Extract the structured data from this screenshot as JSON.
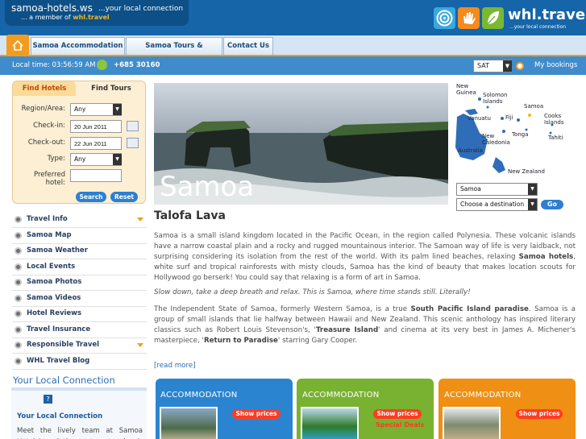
{
  "header": {
    "site_name": "samoa-hotels.ws",
    "tagline": "...your local connection",
    "member_prefix": "... a member of",
    "member_brand": "whl.travel",
    "brand_logo_text": "whl.travel",
    "brand_logo_sub": "...your local connection"
  },
  "nav": {
    "tabs": [
      {
        "label": "Samoa Accommodation"
      },
      {
        "label": "Samoa Tours & Activities"
      },
      {
        "label": "Contact Us"
      }
    ]
  },
  "infobar": {
    "local_time": "Local time: 03:56:59 AM",
    "phone": "+685 30160",
    "currency": "SAT",
    "my_bookings": "My bookings"
  },
  "search": {
    "tab_hotels": "Find Hotels",
    "tab_tours": "Find Tours",
    "region_label": "Region/Area:",
    "region_value": "Any",
    "checkin_label": "Check-in:",
    "checkin_value": "20 Jun 2011",
    "checkout_label": "Check-out:",
    "checkout_value": "22 Jun 2011",
    "type_label": "Type:",
    "type_value": "Any",
    "preferred_label": "Preferred hotel:",
    "preferred_value": "",
    "search_btn": "Search",
    "reset_btn": "Reset"
  },
  "sidebar": {
    "items": [
      {
        "label": "Travel Info"
      },
      {
        "label": "Samoa Map"
      },
      {
        "label": "Samoa Weather"
      },
      {
        "label": "Local Events"
      },
      {
        "label": "Samoa Photos"
      },
      {
        "label": "Samoa Videos"
      },
      {
        "label": "Hotel Reviews"
      },
      {
        "label": "Travel Insurance"
      },
      {
        "label": "Responsible Travel"
      },
      {
        "label": "WHL Travel Blog"
      }
    ],
    "ylc_heading": "Your Local Connection",
    "ylc_title": "Your Local Connection",
    "ylc_text": "Meet the lively team at Samoa Hotel Association, we are your local"
  },
  "hero": {
    "title": "Samoa"
  },
  "map": {
    "labels": [
      "New Guinea",
      "Solomon Islands",
      "Vanuatu",
      "Fiji",
      "Samoa",
      "Cooks Islands",
      "Tonga",
      "Tahiti",
      "New Caledonia",
      "Australia",
      "New Zealand"
    ]
  },
  "destination": {
    "selected": "Samoa",
    "placeholder": "Choose a destination",
    "go": "Go"
  },
  "content": {
    "heading": "Talofa Lava",
    "p1_a": "Samoa is a small island kingdom located in the Pacific Ocean, in the region called Polynesia. These volcanic islands have a narrow coastal plain and a rocky and rugged mountainous interior. The Samoan way of life is very laidback, not surprising considering its isolation from the rest of the world. With its palm lined beaches, relaxing ",
    "p1_bold": "Samoa hotels",
    "p1_b": ", white surf and tropical rainforests with misty clouds, Samoa has the kind of beauty that makes location scouts for Hollywood go berserk! You could say that relaxing is a form of art in Samoa.",
    "p2": "Slow down, take a deep breath and relax. This is Samoa, where time stands still. Literally!",
    "p3_a": "The Independent State of Samoa, formerly Western Samoa, is a true ",
    "p3_bold1": "South Pacific Island paradise",
    "p3_b": ". Samoa is a group of small islands that lie halfway between Hawaii and New Zealand. This scenic anthology has inspired literary classics such as Robert Louis Stevenson's, '",
    "p3_bold2": "Treasure Island",
    "p3_c": "' and cinema at its very best in James A. Michener's masterpiece, '",
    "p3_bold3": "Return to Paradise",
    "p3_d": "' starring Gary Cooper.",
    "read_more": "[read more]"
  },
  "cards": [
    {
      "title": "ACCOMMODATION",
      "show_prices": "Show prices",
      "special": ""
    },
    {
      "title": "ACCOMMODATION",
      "show_prices": "Show prices",
      "special": "Special Deals"
    },
    {
      "title": "ACCOMMODATION",
      "show_prices": "Show prices",
      "special": ""
    }
  ],
  "colors": {
    "header_blue": "#1565a8",
    "accent_orange": "#f29c1f",
    "card_blue": "#2b84cf",
    "card_green": "#78b230",
    "card_orange": "#ef8f13"
  }
}
